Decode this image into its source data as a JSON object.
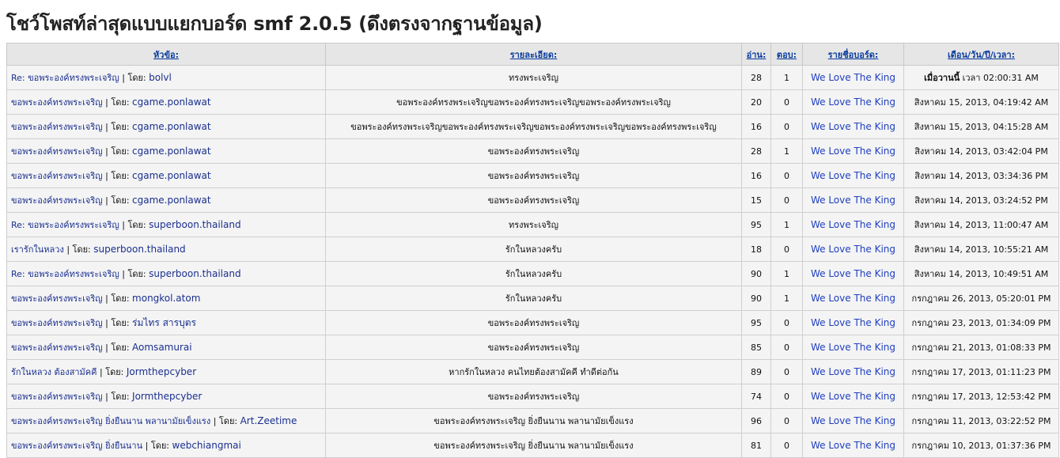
{
  "title": "โชว์โพสท์ล่าสุดแบบแยกบอร์ด smf 2.0.5 (ดึงตรงจากฐานข้อมูล)",
  "columns": {
    "topic": "หัวข้อ:",
    "detail": "รายละเอียด:",
    "views": "อ่าน:",
    "replies": "ตอบ:",
    "board": "รายชื่อบอร์ด:",
    "date": "เดือน/วัน/ปี/เวลา:"
  },
  "by_label": "โดย:",
  "rows": [
    {
      "topic": "Re: ขอพระองค์ทรงพระเจริญ",
      "author": "bolvl",
      "detail": "ทรงพระเจริญ",
      "views": "28",
      "replies": "1",
      "board": "We Love The King",
      "date_bold": "เมื่อวานนี้",
      "date": "เวลา 02:00:31 AM"
    },
    {
      "topic": "ขอพระองค์ทรงพระเจริญ",
      "author": "cgame.ponlawat",
      "detail": "ขอพระองค์ทรงพระเจริญขอพระองค์ทรงพระเจริญขอพระองค์ทรงพระเจริญ",
      "views": "20",
      "replies": "0",
      "board": "We Love The King",
      "date_bold": "",
      "date": "สิงหาคม 15, 2013, 04:19:42 AM"
    },
    {
      "topic": "ขอพระองค์ทรงพระเจริญ",
      "author": "cgame.ponlawat",
      "detail": "ขอพระองค์ทรงพระเจริญขอพระองค์ทรงพระเจริญขอพระองค์ทรงพระเจริญขอพระองค์ทรงพระเจริญ",
      "views": "16",
      "replies": "0",
      "board": "We Love The King",
      "date_bold": "",
      "date": "สิงหาคม 15, 2013, 04:15:28 AM"
    },
    {
      "topic": "ขอพระองค์ทรงพระเจริญ",
      "author": "cgame.ponlawat",
      "detail": "ขอพระองค์ทรงพระเจริญ",
      "views": "28",
      "replies": "1",
      "board": "We Love The King",
      "date_bold": "",
      "date": "สิงหาคม 14, 2013, 03:42:04 PM"
    },
    {
      "topic": "ขอพระองค์ทรงพระเจริญ",
      "author": "cgame.ponlawat",
      "detail": "ขอพระองค์ทรงพระเจริญ",
      "views": "16",
      "replies": "0",
      "board": "We Love The King",
      "date_bold": "",
      "date": "สิงหาคม 14, 2013, 03:34:36 PM"
    },
    {
      "topic": "ขอพระองค์ทรงพระเจริญ",
      "author": "cgame.ponlawat",
      "detail": "ขอพระองค์ทรงพระเจริญ",
      "views": "15",
      "replies": "0",
      "board": "We Love The King",
      "date_bold": "",
      "date": "สิงหาคม 14, 2013, 03:24:52 PM"
    },
    {
      "topic": "Re: ขอพระองค์ทรงพระเจริญ",
      "author": "superboon.thailand",
      "detail": "ทรงพระเจริญ",
      "views": "95",
      "replies": "1",
      "board": "We Love The King",
      "date_bold": "",
      "date": "สิงหาคม 14, 2013, 11:00:47 AM"
    },
    {
      "topic": "เรารักในหลวง",
      "author": "superboon.thailand",
      "detail": "รักในหลวงครับ",
      "views": "18",
      "replies": "0",
      "board": "We Love The King",
      "date_bold": "",
      "date": "สิงหาคม 14, 2013, 10:55:21 AM"
    },
    {
      "topic": "Re: ขอพระองค์ทรงพระเจริญ",
      "author": "superboon.thailand",
      "detail": "รักในหลวงครับ",
      "views": "90",
      "replies": "1",
      "board": "We Love The King",
      "date_bold": "",
      "date": "สิงหาคม 14, 2013, 10:49:51 AM"
    },
    {
      "topic": "ขอพระองค์ทรงพระเจริญ",
      "author": "mongkol.atom",
      "detail": "รักในหลวงครับ",
      "views": "90",
      "replies": "1",
      "board": "We Love The King",
      "date_bold": "",
      "date": "กรกฎาคม 26, 2013, 05:20:01 PM"
    },
    {
      "topic": "ขอพระองค์ทรงพระเจริญ",
      "author": "ร่มไทร สารบุตร",
      "detail": "ขอพระองค์ทรงพระเจริญ",
      "views": "95",
      "replies": "0",
      "board": "We Love The King",
      "date_bold": "",
      "date": "กรกฎาคม 23, 2013, 01:34:09 PM"
    },
    {
      "topic": "ขอพระองค์ทรงพระเจริญ",
      "author": "Aomsamurai",
      "detail": "ขอพระองค์ทรงพระเจริญ",
      "views": "85",
      "replies": "0",
      "board": "We Love The King",
      "date_bold": "",
      "date": "กรกฎาคม 21, 2013, 01:08:33 PM"
    },
    {
      "topic": "รักในหลวง ต้องสามัคคี",
      "author": "Jormthepcyber",
      "detail": "หากรักในหลวง คนไทยต้องสามัคคี ทำดีต่อกัน",
      "views": "89",
      "replies": "0",
      "board": "We Love The King",
      "date_bold": "",
      "date": "กรกฎาคม 17, 2013, 01:11:23 PM"
    },
    {
      "topic": "ขอพระองค์ทรงพระเจริญ",
      "author": "Jormthepcyber",
      "detail": "ขอพระองค์ทรงพระเจริญ",
      "views": "74",
      "replies": "0",
      "board": "We Love The King",
      "date_bold": "",
      "date": "กรกฎาคม 17, 2013, 12:53:42 PM"
    },
    {
      "topic": "ขอพระองค์ทรงพระเจริญ ยิ่งยืนนาน พลานามัยเข็งแรง",
      "author": "Art.Zeetime",
      "detail": "ขอพระองค์ทรงพระเจริญ ยิ่งยืนนาน พลานามัยเข็งแรง",
      "views": "96",
      "replies": "0",
      "board": "We Love The King",
      "date_bold": "",
      "date": "กรกฎาคม 11, 2013, 03:22:52 PM"
    },
    {
      "topic": "ขอพระองค์ทรงพระเจริญ ยิ่งยืนนาน",
      "author": "webchiangmai",
      "detail": "ขอพระองค์ทรงพระเจริญ ยิ่งยืนนาน พลานามัยเข็งแรง",
      "views": "81",
      "replies": "0",
      "board": "We Love The King",
      "date_bold": "",
      "date": "กรกฎาคม 10, 2013, 01:37:36 PM"
    }
  ]
}
